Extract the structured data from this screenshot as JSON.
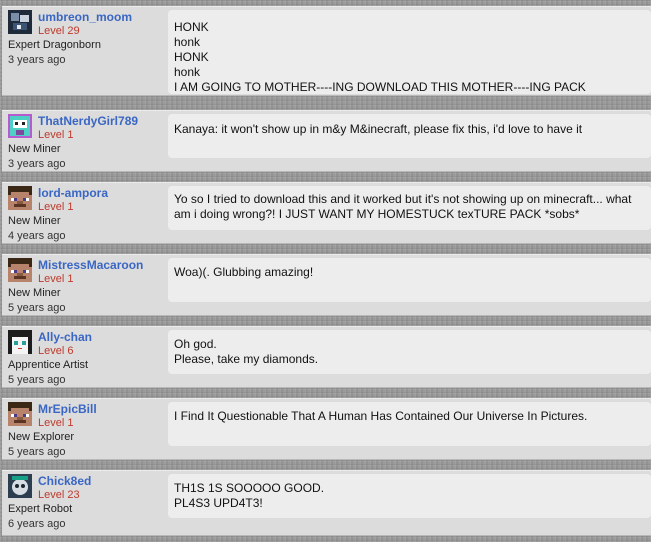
{
  "comments": [
    {
      "username": "umbreon_moom",
      "level": "Level 29",
      "rank": "Expert Dragonborn",
      "time": "3 years ago",
      "avatar": "avatar-umbreon-icon",
      "lines": [
        "HONK",
        "honk",
        "HONK",
        "honk",
        "I AM GOING TO MOTHER----ING DOWNLOAD THIS MOTHER----ING PACK"
      ]
    },
    {
      "username": "ThatNerdyGirl789",
      "level": "Level 1",
      "rank": "New Miner",
      "time": "3 years ago",
      "avatar": "avatar-robot-icon",
      "lines": [
        "Kanaya: it won't show up in m&y M&inecraft, please fix this, i'd love to have it"
      ]
    },
    {
      "username": "lord-ampora",
      "level": "Level 1",
      "rank": "New Miner",
      "time": "4 years ago",
      "avatar": "avatar-steve-icon",
      "lines": [
        "Yo so I tried to download this and it worked but it's not showing up on minecraft... what am i doing wrong?! I JUST WANT MY HOMESTUCK texTURE PACK *sobs*"
      ]
    },
    {
      "username": "MistressMacaroon",
      "level": "Level 1",
      "rank": "New Miner",
      "time": "5 years ago",
      "avatar": "avatar-steve-icon",
      "lines": [
        "Woa)(. Glubbing amazing!"
      ]
    },
    {
      "username": "Ally-chan",
      "level": "Level 6",
      "rank": "Apprentice Artist",
      "time": "5 years ago",
      "avatar": "avatar-anime-icon",
      "lines": [
        "Oh god.",
        "Please, take my diamonds."
      ]
    },
    {
      "username": "MrEpicBill",
      "level": "Level 1",
      "rank": "New Explorer",
      "time": "5 years ago",
      "avatar": "avatar-steve-icon",
      "lines": [
        "I Find It Questionable That A Human Has Contained Our Universe In Pictures."
      ]
    },
    {
      "username": "Chick8ed",
      "level": "Level 23",
      "rank": "Expert Robot",
      "time": "6 years ago",
      "avatar": "avatar-creature-icon",
      "lines": [
        "TH1S 1S SOOOOO GOOD.",
        "PL4S3 UPD4T3!"
      ]
    }
  ]
}
